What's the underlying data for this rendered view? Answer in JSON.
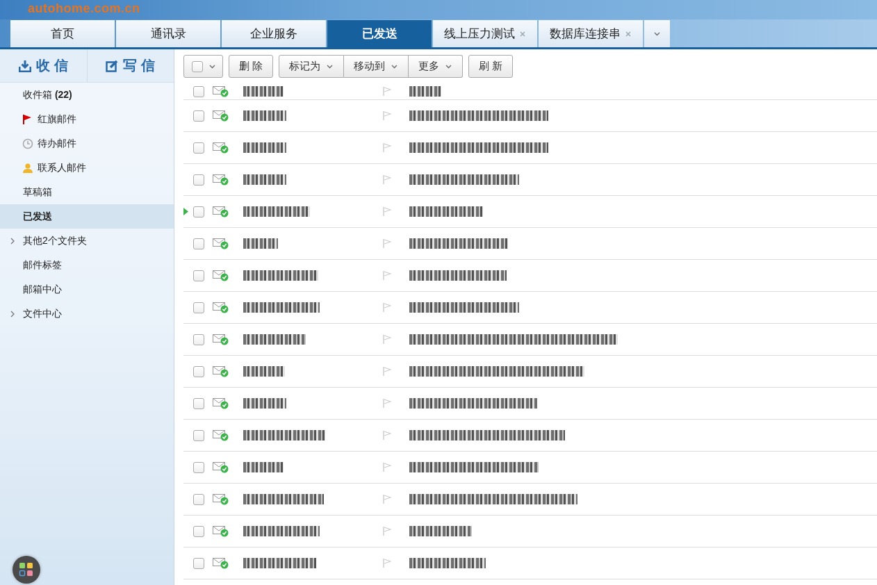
{
  "header": {
    "logo_text": "autohome.com.cn"
  },
  "tabs": [
    {
      "label": "首页",
      "selected": false,
      "closable": false
    },
    {
      "label": "通讯录",
      "selected": false,
      "closable": false
    },
    {
      "label": "企业服务",
      "selected": false,
      "closable": false
    },
    {
      "label": "已发送",
      "selected": true,
      "closable": false
    },
    {
      "label": "线上压力测试",
      "selected": false,
      "closable": true
    },
    {
      "label": "数据库连接串",
      "selected": false,
      "closable": true
    }
  ],
  "sidebar": {
    "actions": [
      {
        "kind": "receive",
        "label": "收 信"
      },
      {
        "kind": "compose",
        "label": "写 信"
      }
    ],
    "items": [
      {
        "label": "收件箱",
        "count": "(22)",
        "selected": false
      },
      {
        "label": "红旗邮件",
        "kind": "flag",
        "selected": false
      },
      {
        "label": "待办邮件",
        "kind": "clock",
        "selected": false
      },
      {
        "label": "联系人邮件",
        "kind": "person",
        "selected": false
      },
      {
        "label": "草稿箱",
        "selected": false
      },
      {
        "label": "已发送",
        "selected": true
      },
      {
        "label": "其他2个文件夹",
        "expanded": false,
        "selected": false
      },
      {
        "label": "邮件标签",
        "selected": false
      },
      {
        "label": "邮箱中心",
        "selected": false
      },
      {
        "label": "文件中心",
        "expanded": false,
        "selected": false
      }
    ]
  },
  "toolbar": {
    "select_all": {
      "checked": false
    },
    "buttons": [
      {
        "label": "删 除",
        "menu": false
      },
      {
        "label": "标记为",
        "menu": true
      },
      {
        "label": "移动到",
        "menu": true
      },
      {
        "label": "更多",
        "menu": true
      },
      {
        "label": "刷 新",
        "menu": false
      }
    ]
  },
  "messages": [
    {
      "checked": false,
      "current": false
    },
    {
      "checked": false,
      "current": false
    },
    {
      "checked": false,
      "current": false
    },
    {
      "checked": false,
      "current": false
    },
    {
      "checked": false,
      "current": true
    },
    {
      "checked": false,
      "current": false
    },
    {
      "checked": false,
      "current": false
    },
    {
      "checked": false,
      "current": false
    },
    {
      "checked": false,
      "current": false
    },
    {
      "checked": false,
      "current": false
    },
    {
      "checked": false,
      "current": false
    },
    {
      "checked": false,
      "current": false
    },
    {
      "checked": false,
      "current": false
    },
    {
      "checked": false,
      "current": false
    },
    {
      "checked": false,
      "current": false
    },
    {
      "checked": false,
      "current": false
    }
  ]
}
